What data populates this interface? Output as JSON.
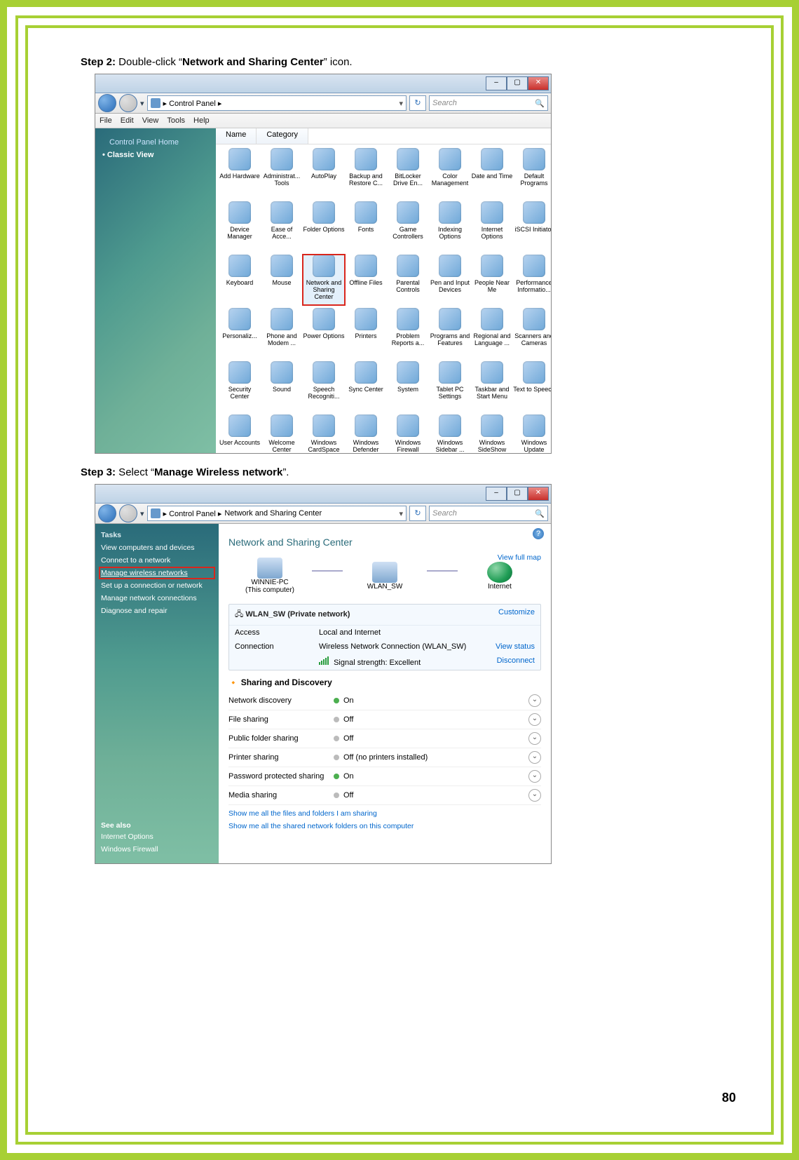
{
  "page_number": "80",
  "step2": {
    "label": "Step 2:",
    "text_before": " Double-click “",
    "bold": "Network and Sharing Center",
    "text_after": "” icon."
  },
  "step3": {
    "label": "Step 3:",
    "text_before": " Select “",
    "bold": "Manage Wireless network",
    "text_after": "”."
  },
  "shot1": {
    "breadcrumb": "Control Panel  ▸",
    "search_placeholder": "Search",
    "menu": [
      "File",
      "Edit",
      "View",
      "Tools",
      "Help"
    ],
    "columns": [
      "Name",
      "Category"
    ],
    "sidebar_home": "Control Panel Home",
    "sidebar_classic": "Classic View",
    "icons": [
      "Add Hardware",
      "Administrat... Tools",
      "AutoPlay",
      "Backup and Restore C...",
      "BitLocker Drive En...",
      "Color Management",
      "Date and Time",
      "Default Programs",
      "Device Manager",
      "Ease of Acce...",
      "Folder Options",
      "Fonts",
      "Game Controllers",
      "Indexing Options",
      "Internet Options",
      "iSCSI Initiator",
      "Keyboard",
      "Mouse",
      "Network and Sharing Center",
      "Offline Files",
      "Parental Controls",
      "Pen and Input Devices",
      "People Near Me",
      "Performance Informatio...",
      "Personaliz...",
      "Phone and Modem ...",
      "Power Options",
      "Printers",
      "Problem Reports a...",
      "Programs and Features",
      "Regional and Language ...",
      "Scanners and Cameras",
      "Security Center",
      "Sound",
      "Speech Recogniti...",
      "Sync Center",
      "System",
      "Tablet PC Settings",
      "Taskbar and Start Menu",
      "Text to Speech",
      "User Accounts",
      "Welcome Center",
      "Windows CardSpace",
      "Windows Defender",
      "Windows Firewall",
      "Windows Sidebar ...",
      "Windows SideShow",
      "Windows Update"
    ],
    "highlight_index": 18
  },
  "shot2": {
    "breadcrumb1": "Control Panel  ▸",
    "breadcrumb2": "Network and Sharing Center",
    "search_placeholder": "Search",
    "tasks_head": "Tasks",
    "tasks": [
      "View computers and devices",
      "Connect to a network",
      "Manage wireless networks",
      "Set up a connection or network",
      "Manage network connections",
      "Diagnose and repair"
    ],
    "task_highlight_index": 2,
    "seealso_head": "See also",
    "seealso": [
      "Internet Options",
      "Windows Firewall"
    ],
    "title": "Network and Sharing Center",
    "view_full_map": "View full map",
    "map_nodes": {
      "pc_name": "WINNIE-PC",
      "pc_sub": "(This computer)",
      "switch": "WLAN_SW",
      "internet": "Internet"
    },
    "wlan_head": "WLAN_SW (Private network)",
    "wlan_customize": "Customize",
    "wlan_access_label": "Access",
    "wlan_access_val": "Local and Internet",
    "wlan_conn_label": "Connection",
    "wlan_conn_val": "Wireless Network Connection (WLAN_SW)",
    "wlan_view_status": "View status",
    "wlan_signal": "Signal strength:  Excellent",
    "wlan_disconnect": "Disconnect",
    "sd_title": "Sharing and Discovery",
    "sd_rows": [
      {
        "label": "Network discovery",
        "state": "on",
        "value": "On"
      },
      {
        "label": "File sharing",
        "state": "off",
        "value": "Off"
      },
      {
        "label": "Public folder sharing",
        "state": "off",
        "value": "Off"
      },
      {
        "label": "Printer sharing",
        "state": "off",
        "value": "Off (no printers installed)"
      },
      {
        "label": "Password protected sharing",
        "state": "on",
        "value": "On"
      },
      {
        "label": "Media sharing",
        "state": "off",
        "value": "Off"
      }
    ],
    "show_link1": "Show me all the files and folders I am sharing",
    "show_link2": "Show me all the shared network folders on this computer"
  }
}
